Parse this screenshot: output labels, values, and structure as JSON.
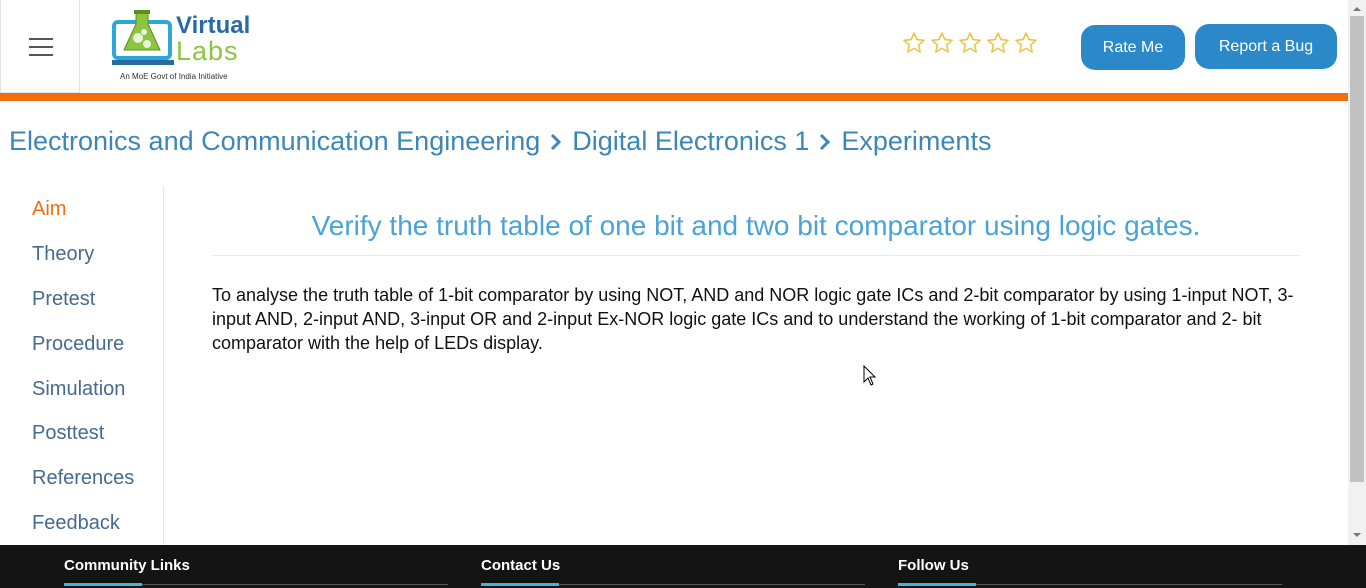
{
  "header": {
    "logo": {
      "word1": "Virtual",
      "word2": "Labs",
      "tagline": "An MoE Govt of India Initiative"
    },
    "rating": {
      "filled": 0,
      "total": 5
    },
    "rate_button": "Rate Me",
    "bug_button": "Report a Bug"
  },
  "breadcrumb": {
    "items": [
      "Electronics and Communication Engineering",
      "Digital Electronics 1",
      "Experiments"
    ]
  },
  "sidebar": {
    "items": [
      "Aim",
      "Theory",
      "Pretest",
      "Procedure",
      "Simulation",
      "Posttest",
      "References",
      "Feedback"
    ],
    "active": "Aim"
  },
  "main": {
    "title": "Verify the truth table of one bit and two bit comparator using logic gates.",
    "aim_text": "To analyse the truth table of 1-bit comparator by using NOT, AND and NOR logic gate ICs and 2-bit comparator by using 1-input NOT, 3-input AND, 2-input AND, 3-input OR and 2-input Ex-NOR logic gate ICs and to understand the working of 1-bit comparator and 2- bit comparator with the help of LEDs display."
  },
  "footer": {
    "columns": [
      "Community Links",
      "Contact Us",
      "Follow Us"
    ]
  },
  "colors": {
    "accent_orange": "#f26d0f",
    "button_blue": "#2b89c9",
    "title_blue": "#4aa3d6",
    "footer_bg": "#141414"
  },
  "icons": [
    "menu-icon",
    "star-outline-icon",
    "chevron-right-icon",
    "mouse-cursor-icon"
  ]
}
